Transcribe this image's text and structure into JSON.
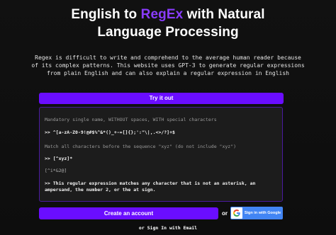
{
  "hero": {
    "title_part1": "English to ",
    "title_accent": "RegEx",
    "title_part2": " with Natural",
    "title_line2": "Language Processing",
    "accent_color": "#8a3cff"
  },
  "description": "Regex is difficult to write and comprehend to the average human reader because of its complex patterns. This website uses GPT-3 to generate regular expressions from plain English and can also explain a regular expression in English",
  "try_button_label": "Try it out",
  "examples": {
    "prompt1": "Mandatory single name, WITHOUT spaces, WITH special characters",
    "answer1": ">> ^[a-zA-Z0-9!@#$%^&*()_+-=[]{};':\"\\|,.<>/?]+$",
    "prompt2": "Match all characters before the sequence \"xyz\" (do not include \"xyz\")",
    "answer2": ">> [^xyz]*",
    "prompt3": "[^i*&2@]",
    "answer3": ">> This regular expression matches any character that is not an asterisk, an ampersand, the number 2, or the at sign."
  },
  "auth": {
    "create_account_label": "Create an account",
    "or_label": "or",
    "google_label": "Sign in with Google",
    "email_signin_label": "or Sign In with Email"
  },
  "colors": {
    "primary": "#6a0dff",
    "panel_border": "#4a1aa0",
    "google_blue": "#4285f4"
  }
}
